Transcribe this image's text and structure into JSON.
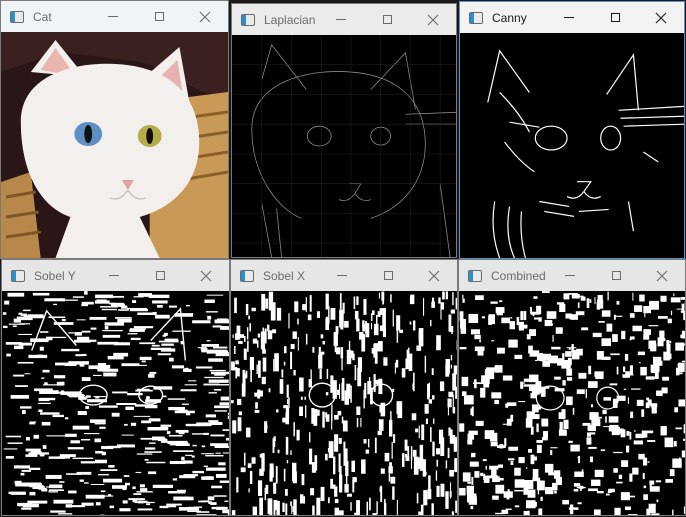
{
  "windows": {
    "cat": {
      "title": "Cat",
      "titlebar_color": "#eff4f9",
      "image": "cat-photo",
      "active": false
    },
    "laplacian": {
      "title": "Laplacian",
      "titlebar_color": "#ebebeb",
      "image": "laplacian-edge-map",
      "active": false
    },
    "canny": {
      "title": "Canny",
      "titlebar_color": "#f3f3f3",
      "image": "canny-edge-map",
      "active": true
    },
    "sobel_y": {
      "title": "Sobel Y",
      "titlebar_color": "#e6e6e6",
      "image": "sobel-y-edge-map",
      "active": false
    },
    "sobel_x": {
      "title": "Sobel X",
      "titlebar_color": "#e6e6e6",
      "image": "sobel-x-edge-map",
      "active": false
    },
    "combined": {
      "title": "Combined",
      "titlebar_color": "#e6e6e6",
      "image": "combined-edge-map",
      "active": false
    }
  },
  "caption_buttons": [
    "minimize",
    "maximize",
    "close"
  ],
  "colors": {
    "desktop": "#1a1a1a",
    "edge_black": "#000000",
    "edge_white": "#ffffff",
    "fur": "#f2efec",
    "basket": "#c89a55",
    "blue_eye": "#5d8fc4",
    "green_eye": "#b4ad48"
  }
}
